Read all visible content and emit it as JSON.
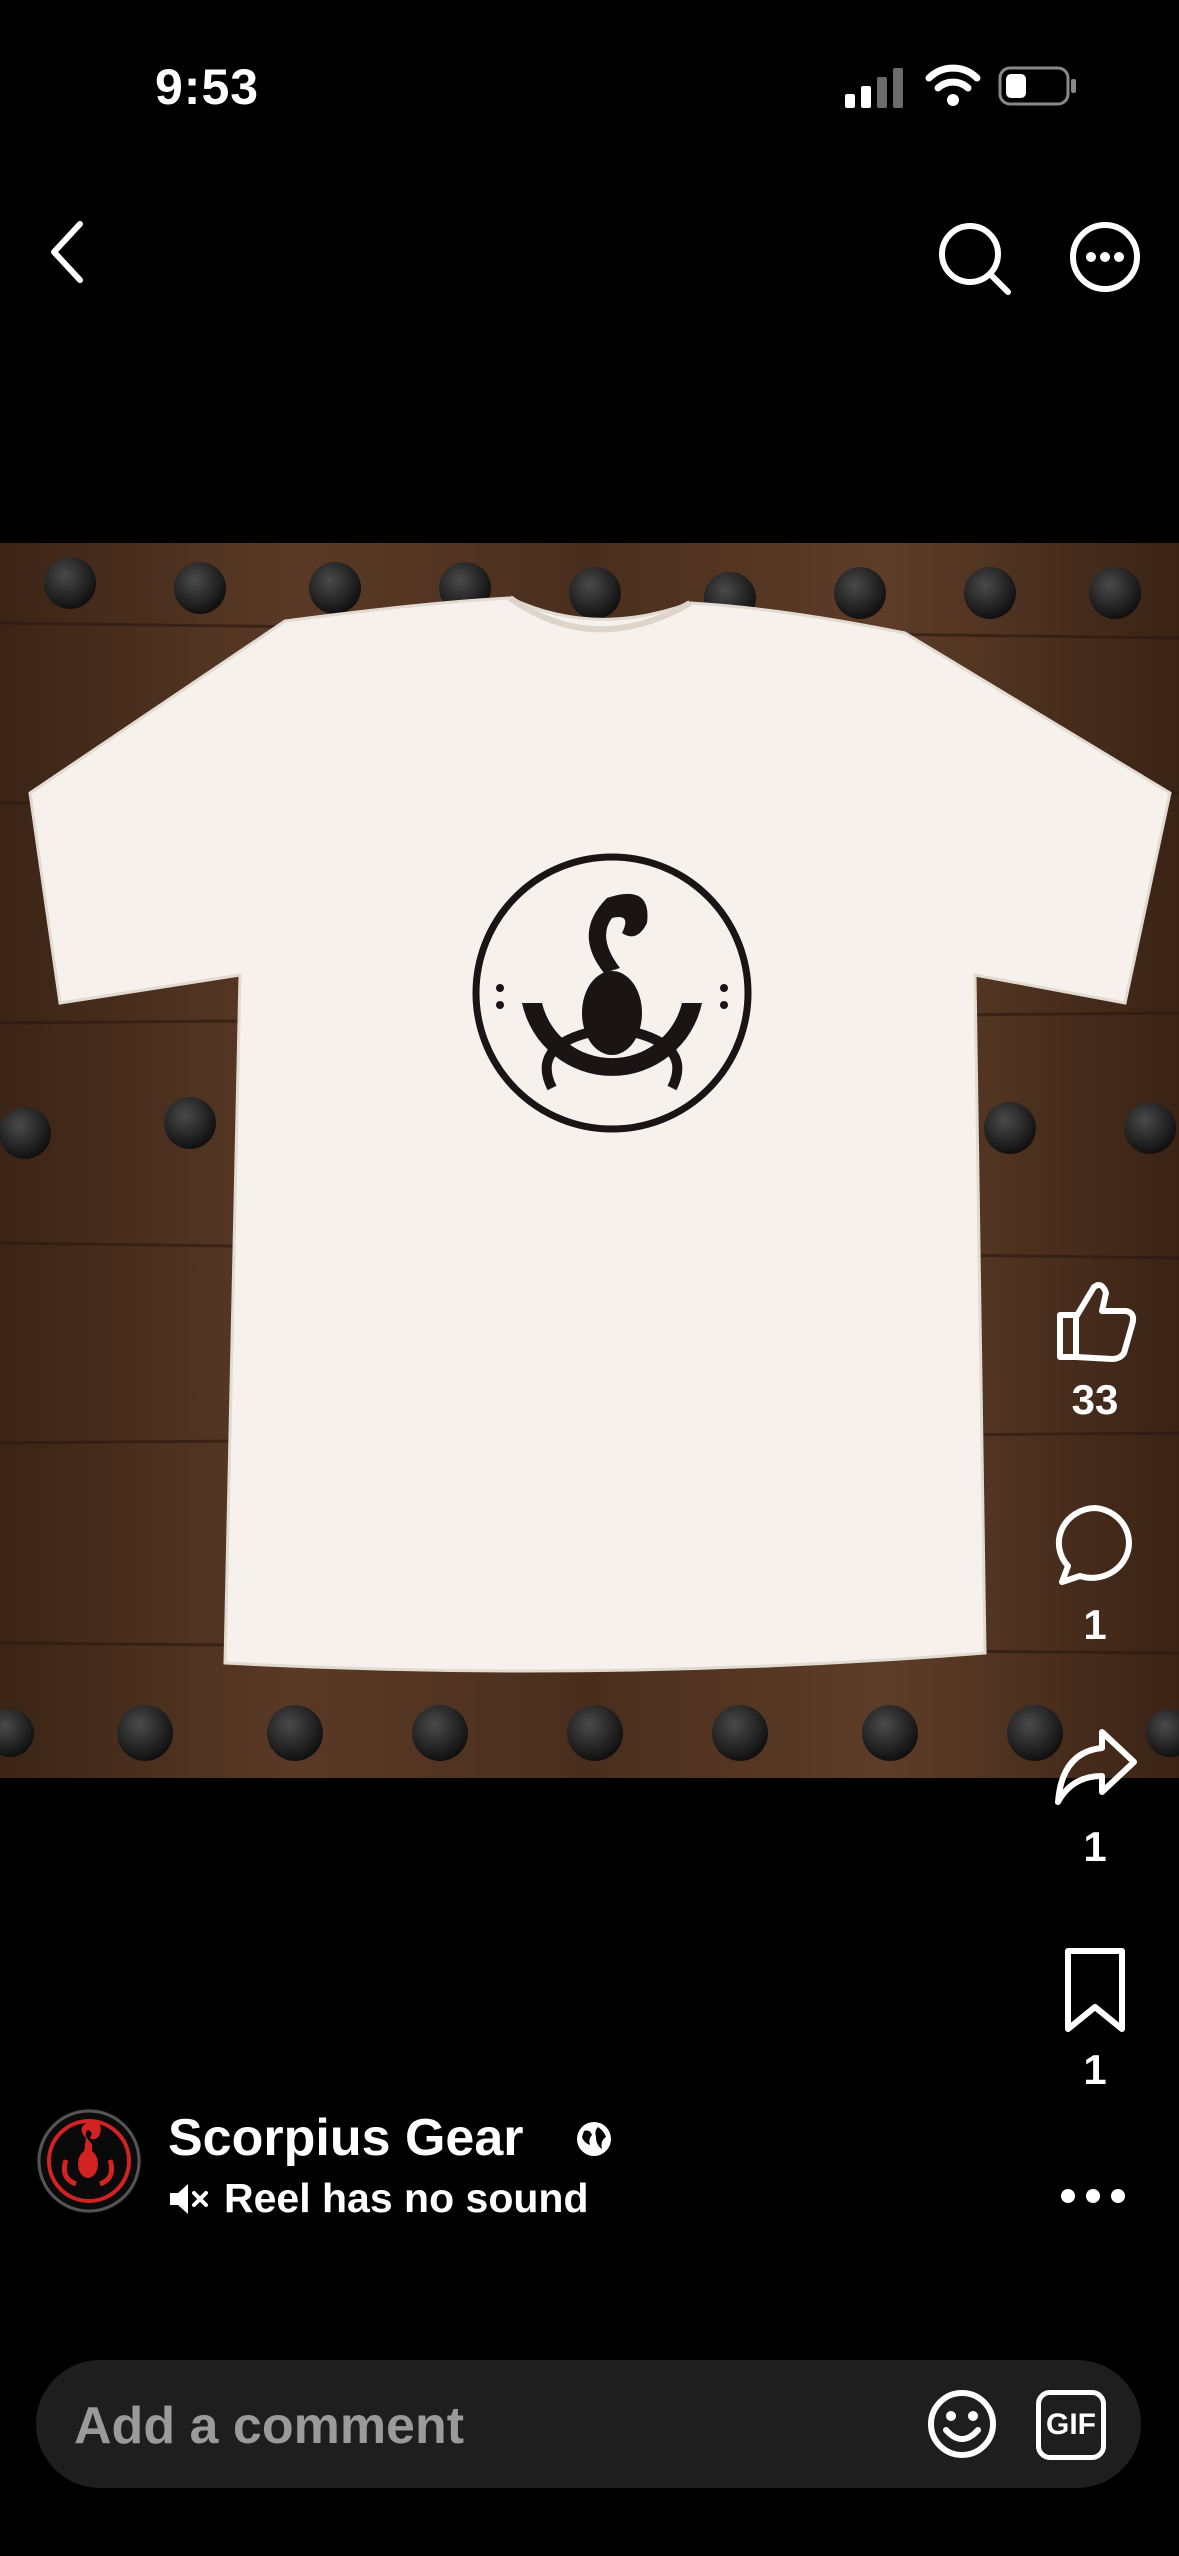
{
  "status_bar": {
    "time": "9:53"
  },
  "top_nav": {
    "back_icon": "chevron-left-icon",
    "search_icon": "search-icon",
    "more_icon": "more-circle-icon"
  },
  "media": {
    "description_icon": "tshirt-scorpion-photo"
  },
  "actions": {
    "like_count": "33",
    "comment_count": "1",
    "share_count": "1",
    "save_count": "1"
  },
  "author": {
    "name": "Scorpius Gear",
    "visibility_icon": "globe-icon"
  },
  "sound": {
    "label": "Reel has no sound",
    "icon": "speaker-muted-icon"
  },
  "comment_bar": {
    "placeholder": "Add a comment",
    "emoji_icon": "emoji-icon",
    "gif_label": "GIF"
  },
  "colors": {
    "background": "#000000",
    "comment_bar": "#1e1e1e",
    "placeholder": "#9a9a9a",
    "avatar_accent": "#d32222"
  }
}
